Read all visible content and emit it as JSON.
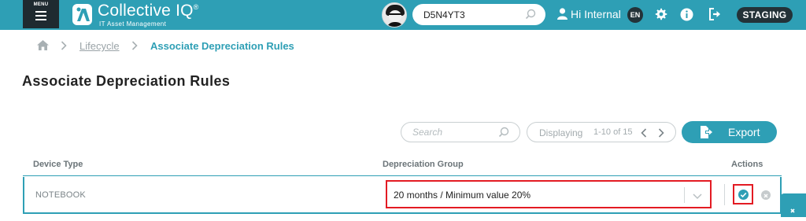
{
  "header": {
    "menu_label": "MENU",
    "brand_title": "Collective IQ",
    "brand_mark": "®",
    "brand_subtitle": "IT Asset Management",
    "search_value": "D5N4YT3",
    "user_greeting": "Hi Internal",
    "language": "EN",
    "environment": "STAGING",
    "icons": [
      "menu-icon",
      "logo-icon",
      "avatar",
      "search-icon",
      "user-icon",
      "gear-icon",
      "info-icon",
      "logout-icon"
    ]
  },
  "breadcrumb": {
    "home_icon": "home-icon",
    "items": [
      "Lifecycle",
      "Associate Depreciation Rules"
    ]
  },
  "page": {
    "title": "Associate Depreciation Rules"
  },
  "toolbar": {
    "search_placeholder": "Search",
    "display_label": "Displaying",
    "range": "1-10 of 15",
    "export_label": "Export"
  },
  "table": {
    "columns": [
      "Device Type",
      "Depreciation Group",
      "Actions"
    ],
    "rows": [
      {
        "device_type": "NOTEBOOK",
        "depreciation_group": "20 months / Minimum value 20%"
      }
    ]
  },
  "colors": {
    "primary": "#2e9fb5",
    "dark": "#233238",
    "highlight": "#e31b23"
  }
}
